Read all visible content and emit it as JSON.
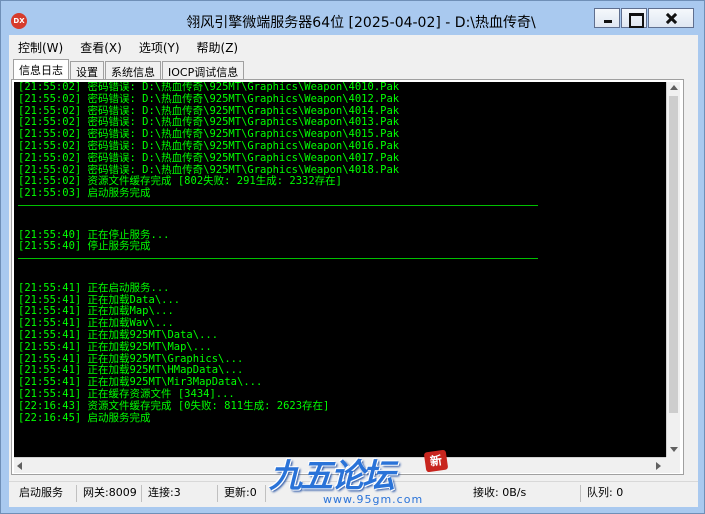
{
  "window": {
    "title": "翎风引擎微端服务器64位 [2025-04-02] - D:\\热血传奇\\",
    "app_icon": "DX"
  },
  "menu": [
    {
      "label": "控制(W)"
    },
    {
      "label": "查看(X)"
    },
    {
      "label": "选项(Y)"
    },
    {
      "label": "帮助(Z)"
    }
  ],
  "tabs": [
    {
      "label": "信息日志",
      "active": true
    },
    {
      "label": "设置",
      "active": false
    },
    {
      "label": "系统信息",
      "active": false
    },
    {
      "label": "IOCP调试信息",
      "active": false
    }
  ],
  "log": {
    "group1": [
      "[21:55:02] 密码错误: D:\\热血传奇\\925MT\\Graphics\\Weapon\\4010.Pak",
      "[21:55:02] 密码错误: D:\\热血传奇\\925MT\\Graphics\\Weapon\\4012.Pak",
      "[21:55:02] 密码错误: D:\\热血传奇\\925MT\\Graphics\\Weapon\\4014.Pak",
      "[21:55:02] 密码错误: D:\\热血传奇\\925MT\\Graphics\\Weapon\\4013.Pak",
      "[21:55:02] 密码错误: D:\\热血传奇\\925MT\\Graphics\\Weapon\\4015.Pak",
      "[21:55:02] 密码错误: D:\\热血传奇\\925MT\\Graphics\\Weapon\\4016.Pak",
      "[21:55:02] 密码错误: D:\\热血传奇\\925MT\\Graphics\\Weapon\\4017.Pak",
      "[21:55:02] 密码错误: D:\\热血传奇\\925MT\\Graphics\\Weapon\\4018.Pak",
      "[21:55:02] 资源文件缓存完成 [802失败: 291生成: 2332存在]",
      "[21:55:03] 启动服务完成"
    ],
    "group2": [
      "[21:55:40] 正在停止服务...",
      "[21:55:40] 停止服务完成"
    ],
    "group3": [
      "[21:55:41] 正在启动服务...",
      "[21:55:41] 正在加载Data\\...",
      "[21:55:41] 正在加载Map\\...",
      "[21:55:41] 正在加载Wav\\...",
      "[21:55:41] 正在加载925MT\\Data\\...",
      "[21:55:41] 正在加载925MT\\Map\\...",
      "[21:55:41] 正在加载925MT\\Graphics\\...",
      "[21:55:41] 正在加载925MT\\HMapData\\...",
      "[21:55:41] 正在加载925MT\\Mir3MapData\\...",
      "[21:55:41] 正在缓存资源文件 [3434]...",
      "[22:16:43] 资源文件缓存完成 [0失败: 811生成: 2623存在]",
      "[22:16:45] 启动服务完成"
    ]
  },
  "status": {
    "state": "启动服务",
    "gateway": "网关:8009",
    "connections": "连接:3",
    "update": "更新:0",
    "receive": "接收: 0B/s",
    "queue": "队列: 0"
  },
  "watermark": {
    "text": "九五论坛",
    "url": "www.95gm.com",
    "seal": "新"
  },
  "colors": {
    "log_text": "#00ff00",
    "console_bg": "#000000",
    "title_bg": "#a9c9ef"
  }
}
